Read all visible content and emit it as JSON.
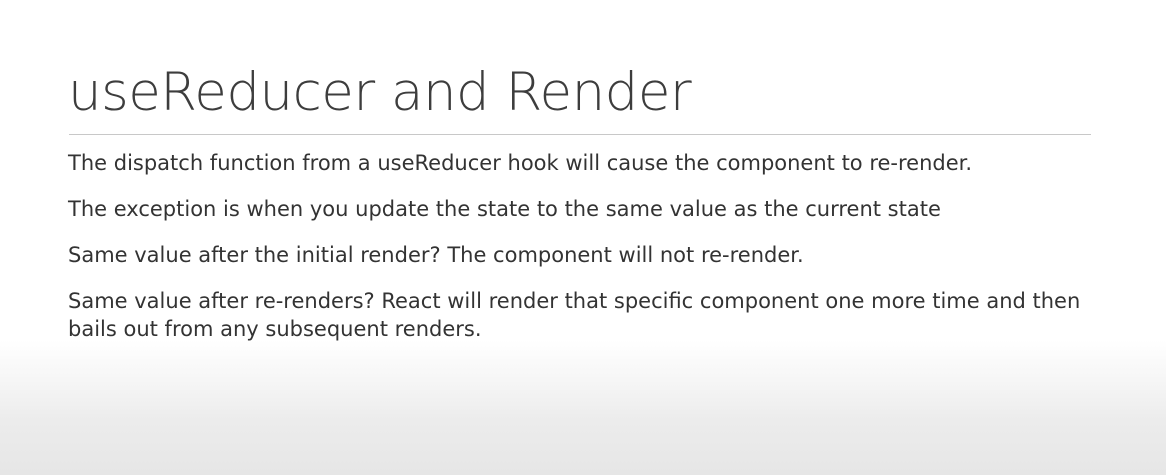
{
  "slide": {
    "title": "useReducer and Render",
    "bullets": [
      "The dispatch function from a useReducer hook will cause the component to re-render.",
      "The exception is when you update the state to the same value as the current state",
      "Same value after the initial render? The component will not re-render.",
      "Same value after re-renders? React will render that specific component one more time and then bails out from any subsequent renders."
    ]
  }
}
